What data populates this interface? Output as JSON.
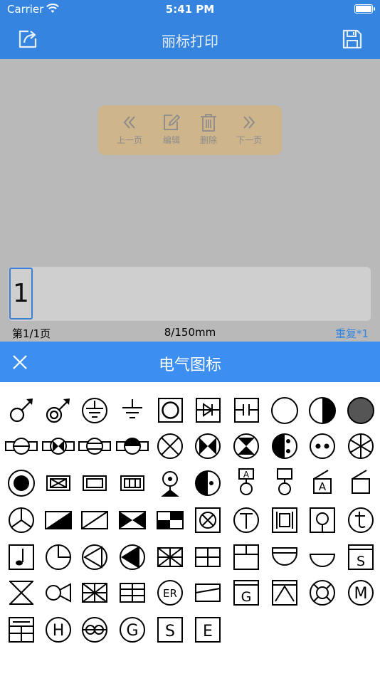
{
  "status": {
    "carrier": "Carrier",
    "time": "5:41 PM"
  },
  "nav": {
    "title": "丽标打印"
  },
  "popup": {
    "prev": "上一页",
    "edit": "编辑",
    "delete": "删除",
    "next": "下一页"
  },
  "label": {
    "char": "1"
  },
  "info": {
    "page": "第1/1页",
    "size": "8/150mm",
    "repeat": "重复*1"
  },
  "panel": {
    "title": "电气图标"
  },
  "icons": [
    "male-symbol",
    "male-double-symbol",
    "ground-circle",
    "ground",
    "square-circle",
    "diode-box",
    "capacitor-box",
    "circle",
    "half-filled-circle",
    "hatched-circle",
    "lamp-line",
    "lamp-filled-x",
    "lamp-double-line",
    "lamp-half",
    "lamp-x",
    "bowtie-circle",
    "hourglass-circle",
    "socket-dots",
    "socket-two-dots",
    "circle-asterisk",
    "filled-dot-circle",
    "box-x",
    "box-rect",
    "box-three-bars",
    "motion-sensor",
    "half-dot-circle",
    "circle-a-box",
    "box-circle",
    "diagonal-a-box",
    "diagonal-box",
    "peace-circle",
    "diagonal-half-fill",
    "diagonal-box-line",
    "bowtie-box",
    "checker-box",
    "box-circle-x",
    "circle-t",
    "box-bracket",
    "box-pendant",
    "circle-t-lower",
    "box-note",
    "clock-circle",
    "triangle-circle",
    "filled-triangle-circle",
    "union-jack-box",
    "cross-box",
    "t-box",
    "half-circle-box",
    "half-circle",
    "s-box-top",
    "hourglass",
    "fish",
    "union-jack-box-2",
    "grid-box",
    "circle-er",
    "slanted-box",
    "g-box",
    "triangle-box",
    "lifebuoy",
    "circle-m",
    "hatched-cross-box",
    "circle-h",
    "double-circle",
    "circle-g",
    "s-box",
    "e-box"
  ]
}
